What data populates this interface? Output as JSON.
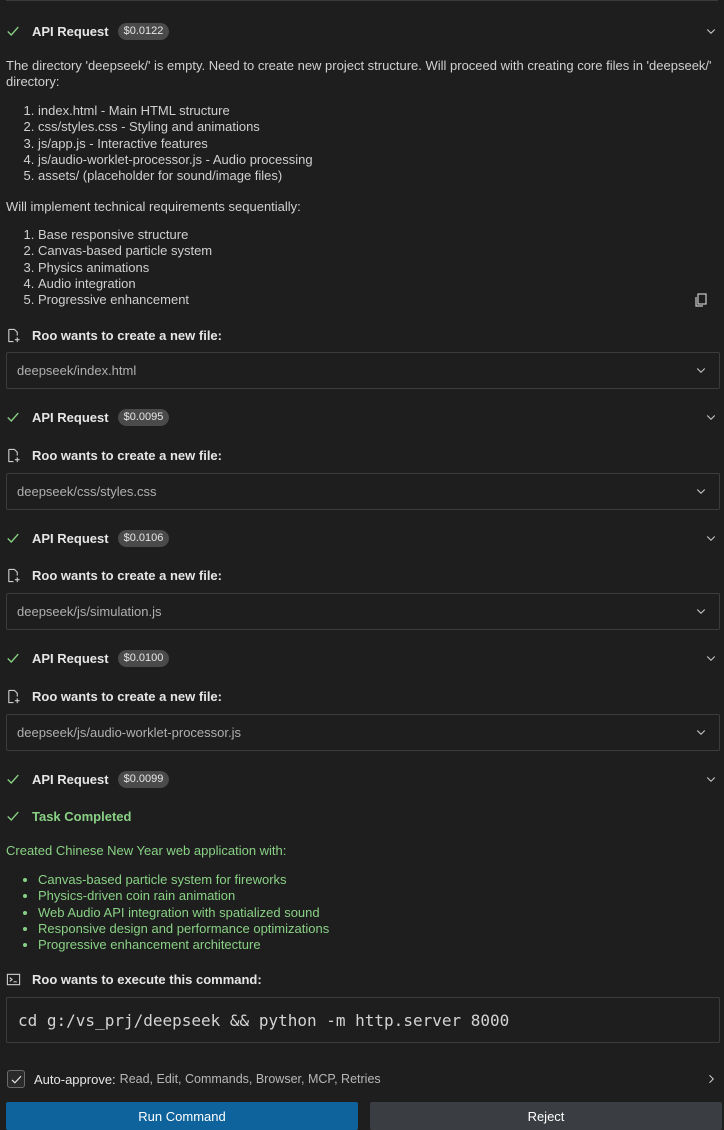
{
  "colors": {
    "success": "#89d185",
    "primary_button": "#0e639c",
    "secondary_button": "#3a3d41",
    "background": "#1e1e1e"
  },
  "requests": [
    {
      "label": "API Request",
      "cost": "$0.0122"
    },
    {
      "label": "API Request",
      "cost": "$0.0095"
    },
    {
      "label": "API Request",
      "cost": "$0.0106"
    },
    {
      "label": "API Request",
      "cost": "$0.0100"
    },
    {
      "label": "API Request",
      "cost": "$0.0099"
    }
  ],
  "message": {
    "intro": "The directory 'deepseek/' is empty. Need to create new project structure. Will proceed with creating core files in 'deepseek/' directory:",
    "files": [
      "index.html - Main HTML structure",
      "css/styles.css - Styling and animations",
      "js/app.js - Interactive features",
      "js/audio-worklet-processor.js - Audio processing",
      "assets/ (placeholder for sound/image files)"
    ],
    "requirements_intro": "Will implement technical requirements sequentially:",
    "requirements": [
      "Base responsive structure",
      "Canvas-based particle system",
      "Physics animations",
      "Audio integration",
      "Progressive enhancement"
    ]
  },
  "create_file_label": "Roo wants to create a new file:",
  "created_files": [
    "deepseek/index.html",
    "deepseek/css/styles.css",
    "deepseek/js/simulation.js",
    "deepseek/js/audio-worklet-processor.js"
  ],
  "task": {
    "title": "Task Completed",
    "summary": "Created Chinese New Year web application with:",
    "items": [
      "Canvas-based particle system for fireworks",
      "Physics-driven coin rain animation",
      "Web Audio API integration with spatialized sound",
      "Responsive design and performance optimizations",
      "Progressive enhancement architecture"
    ]
  },
  "execute": {
    "label": "Roo wants to execute this command:",
    "command": "cd g:/vs_prj/deepseek && python -m http.server 8000"
  },
  "auto_approve": {
    "label": "Auto-approve:",
    "items": "Read, Edit, Commands, Browser, MCP, Retries"
  },
  "buttons": {
    "run": "Run Command",
    "reject": "Reject"
  }
}
